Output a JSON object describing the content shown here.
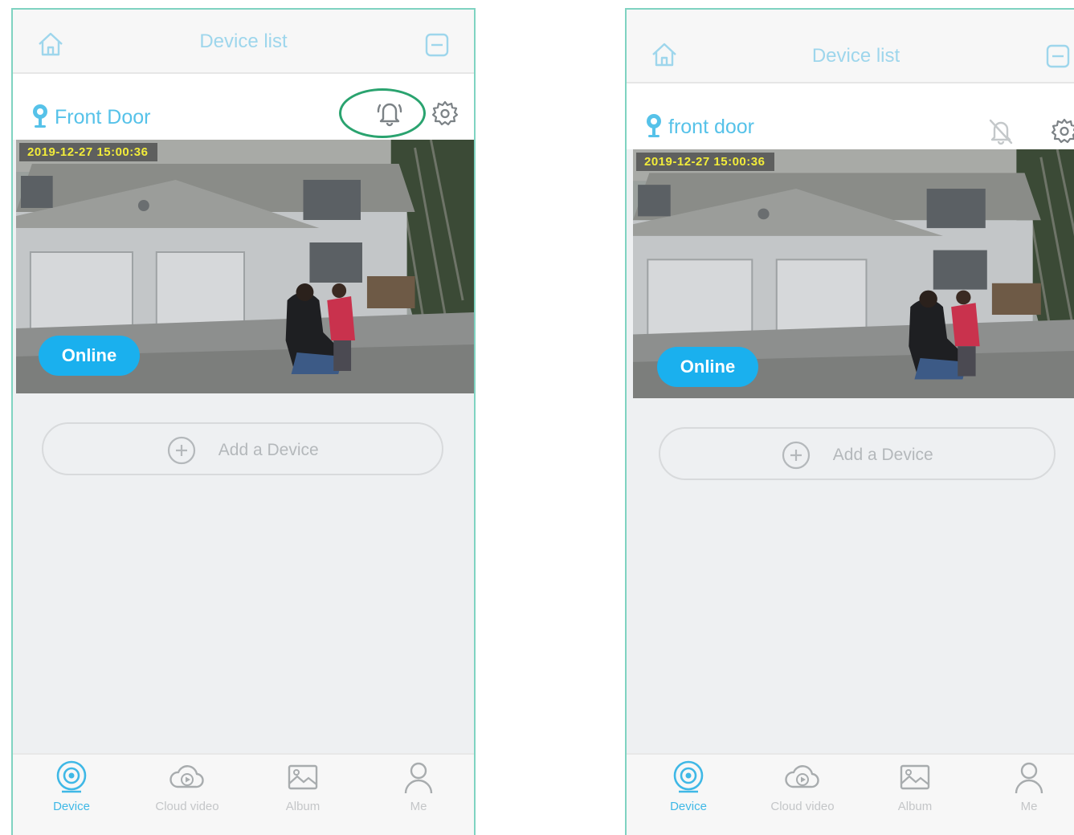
{
  "colors": {
    "accent": "#3fb8e6",
    "online_badge": "#1ab0ee",
    "highlight_ring": "#2aa36f",
    "frame_border": "#7fd3c1",
    "timestamp_text": "#f2ec3a"
  },
  "screens": [
    {
      "header": {
        "title": "Device list",
        "left_icon": "home-icon",
        "right_icon": "menu-icon"
      },
      "device": {
        "name": "Front Door",
        "alarm_icon": "bell-icon",
        "alarm_state": "on",
        "alarm_highlighted": true,
        "settings_icon": "gear-icon",
        "timestamp": "2019-12-27  15:00:36",
        "status": "Online"
      },
      "add_device_label": "Add a Device",
      "tabs": [
        {
          "label": "Device",
          "icon": "camera-icon",
          "active": true
        },
        {
          "label": "Cloud video",
          "icon": "cloud-play-icon",
          "active": false
        },
        {
          "label": "Album",
          "icon": "album-icon",
          "active": false
        },
        {
          "label": "Me",
          "icon": "person-icon",
          "active": false
        }
      ]
    },
    {
      "header": {
        "title": "Device list",
        "left_icon": "home-icon",
        "right_icon": "menu-icon"
      },
      "device": {
        "name": "front door",
        "alarm_icon": "bell-off-icon",
        "alarm_state": "off",
        "alarm_highlighted": false,
        "settings_icon": "gear-icon",
        "timestamp": "2019-12-27  15:00:36",
        "status": "Online"
      },
      "add_device_label": "Add a Device",
      "tabs": [
        {
          "label": "Device",
          "icon": "camera-icon",
          "active": true
        },
        {
          "label": "Cloud video",
          "icon": "cloud-play-icon",
          "active": false
        },
        {
          "label": "Album",
          "icon": "album-icon",
          "active": false
        },
        {
          "label": "Me",
          "icon": "person-icon",
          "active": false
        }
      ]
    }
  ]
}
